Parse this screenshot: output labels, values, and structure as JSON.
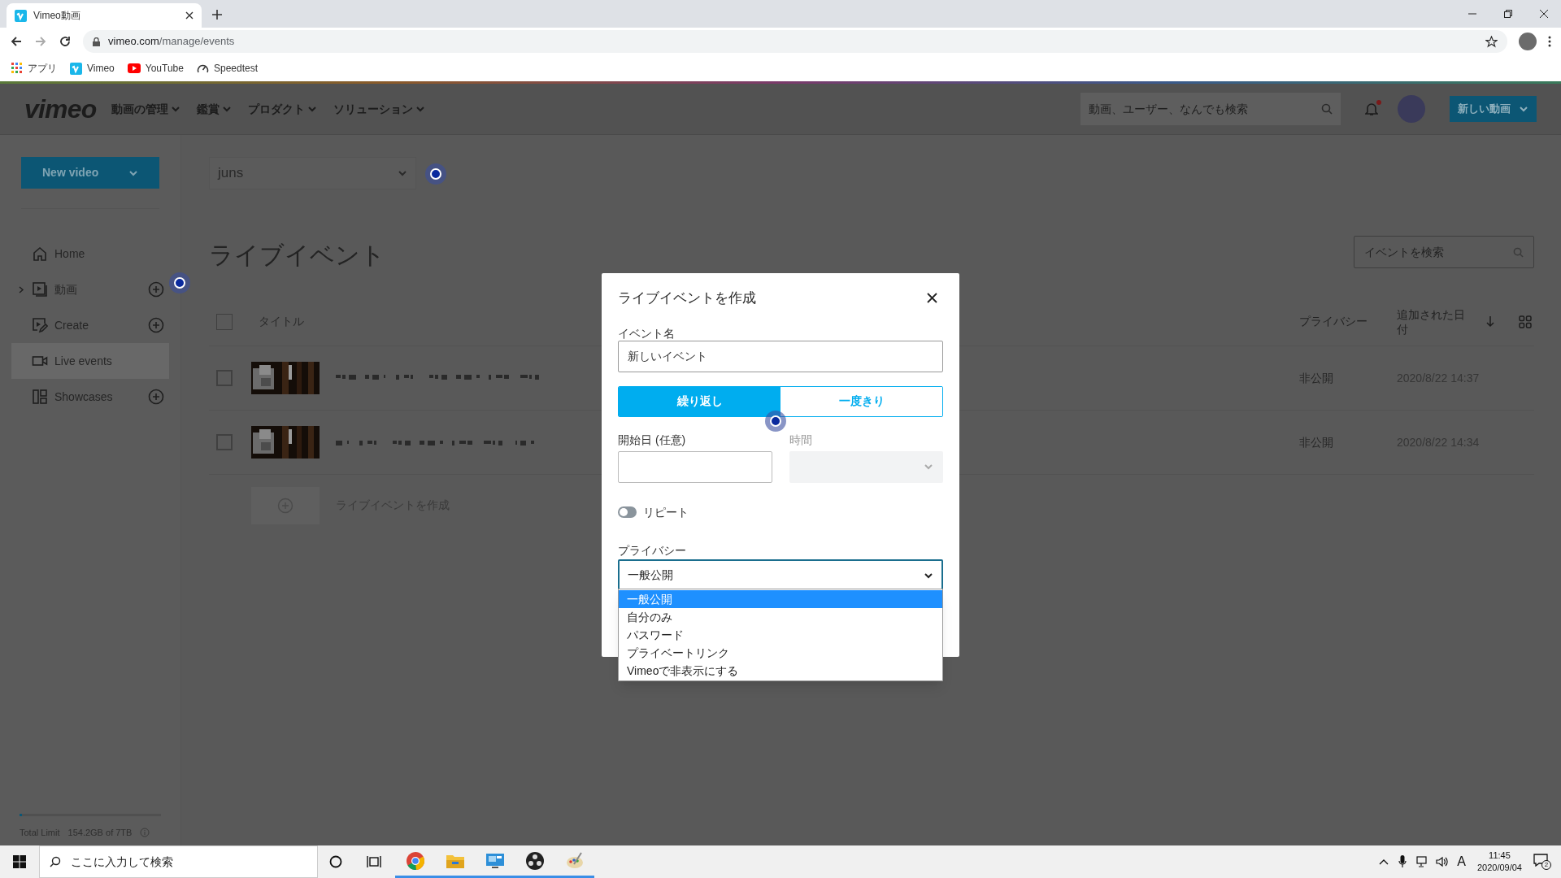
{
  "browser": {
    "tab_title": "Vimeo動画",
    "address_domain": "vimeo.com",
    "address_path": "/manage/events",
    "bookmarks": [
      {
        "label": "アプリ",
        "kind": "apps"
      },
      {
        "label": "Vimeo",
        "kind": "vimeo"
      },
      {
        "label": "YouTube",
        "kind": "youtube"
      },
      {
        "label": "Speedtest",
        "kind": "speed"
      }
    ]
  },
  "header": {
    "logo": "vimeo",
    "nav": [
      "動画の管理",
      "鑑賞",
      "プロダクト",
      "ソリューション"
    ],
    "search_placeholder": "動画、ユーザー、なんでも検索",
    "new_button": "新しい動画"
  },
  "sidebar": {
    "new_video": "New video",
    "items": [
      {
        "label": "Home",
        "kind": "home",
        "selected": false,
        "expandable": false,
        "addable": false
      },
      {
        "label": "動画",
        "kind": "video",
        "selected": false,
        "expandable": true,
        "addable": true
      },
      {
        "label": "Create",
        "kind": "create",
        "selected": false,
        "expandable": false,
        "addable": true
      },
      {
        "label": "Live events",
        "kind": "live",
        "selected": true,
        "expandable": false,
        "addable": false
      },
      {
        "label": "Showcases",
        "kind": "showcase",
        "selected": false,
        "expandable": false,
        "addable": true
      }
    ],
    "storage": {
      "label": "Total Limit",
      "value": "154.2GB of 7TB",
      "level": 0.02
    }
  },
  "main": {
    "account": "juns",
    "title": "ライブイベント",
    "search_placeholder": "イベントを検索",
    "columns": [
      "タイトル",
      "プライバシー",
      "追加された日付"
    ],
    "select_all_checked": false,
    "rows": [
      {
        "checked": false,
        "privacy": "非公開",
        "date": "2020/8/22 14:37"
      },
      {
        "checked": false,
        "privacy": "非公開",
        "date": "2020/8/22 14:34"
      }
    ],
    "create_label": "ライブイベントを作成"
  },
  "modal": {
    "title": "ライブイベントを作成",
    "name_label": "イベント名",
    "name_value": "新しいイベント",
    "segments": [
      {
        "label": "繰り返し",
        "selected": true
      },
      {
        "label": "一度きり",
        "selected": false
      }
    ],
    "date_label": "開始日 (任意)",
    "time_label": "時間",
    "repeat_label": "リピート",
    "repeat_on": false,
    "privacy_label": "プライバシー",
    "privacy_value": "一般公開",
    "options": [
      {
        "label": "一般公開",
        "selected": true
      },
      {
        "label": "自分のみ",
        "selected": false
      },
      {
        "label": "パスワード",
        "selected": false
      },
      {
        "label": "プライベートリンク",
        "selected": false
      },
      {
        "label": "Vimeoで非表示にする",
        "selected": false
      }
    ]
  },
  "taskbar": {
    "search_placeholder": "ここに入力して検索",
    "time": "11:45",
    "date": "2020/09/04",
    "notifications": "2",
    "ime": "A"
  }
}
